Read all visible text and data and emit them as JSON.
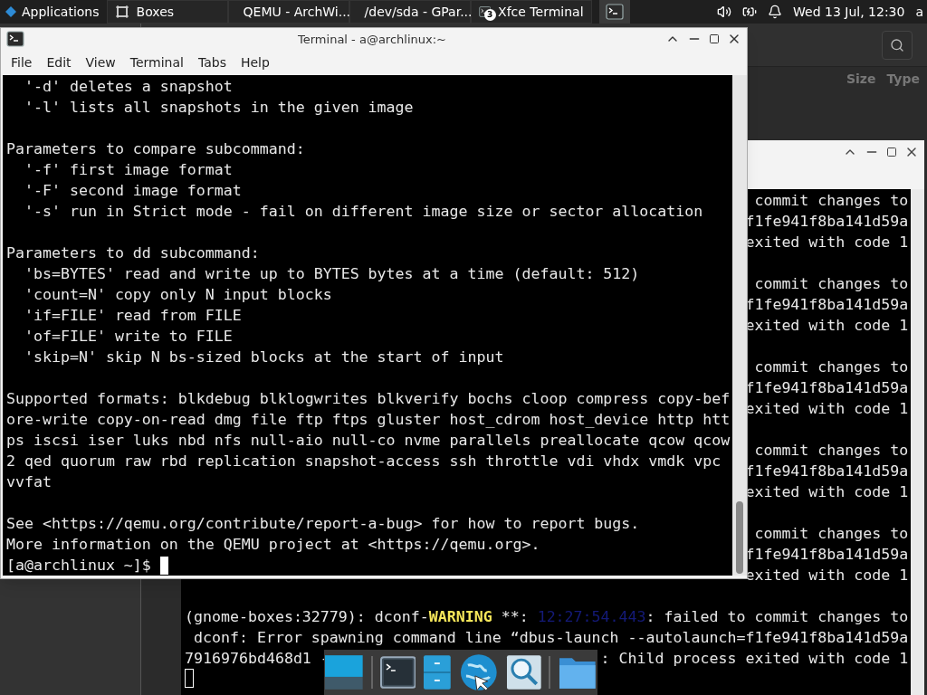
{
  "panel": {
    "app_menu": "Applications",
    "tasks": [
      {
        "label": "Boxes",
        "kind": "boxes"
      },
      {
        "label": "QEMU - ArchWi...",
        "kind": "browser"
      },
      {
        "label": "/dev/sda - GPar...",
        "kind": "disk"
      },
      {
        "label": "Xfce Terminal",
        "kind": "terminal",
        "badge": "3"
      }
    ],
    "clock": "Wed 13 Jul, 12:30",
    "user": "a"
  },
  "boxes_window": {
    "columns": [
      "Size",
      "Type"
    ]
  },
  "terminal": {
    "title": "Terminal - a@archlinux:~",
    "menu": [
      "File",
      "Edit",
      "View",
      "Terminal",
      "Tabs",
      "Help"
    ],
    "blocks": [
      [
        "  '-d' deletes a snapshot",
        "  '-l' lists all snapshots in the given image"
      ],
      [
        "Parameters to compare subcommand:",
        "  '-f' first image format",
        "  '-F' second image format",
        "  '-s' run in Strict mode - fail on different image size or sector allocation"
      ],
      [
        "Parameters to dd subcommand:",
        "  'bs=BYTES' read and write up to BYTES bytes at a time (default: 512)",
        "  'count=N' copy only N input blocks",
        "  'if=FILE' read from FILE",
        "  'of=FILE' write to FILE",
        "  'skip=N' skip N bs-sized blocks at the start of input"
      ],
      [
        "Supported formats: blkdebug blklogwrites blkverify bochs cloop compress copy-bef",
        "ore-write copy-on-read dmg file ftp ftps gluster host_cdrom host_device http htt",
        "ps iscsi iser luks nbd nfs null-aio null-co nvme parallels preallocate qcow qcow",
        "2 qed quorum raw rbd replication snapshot-access ssh throttle vdi vhdx vmdk vpc",
        "vvfat"
      ],
      [
        "See <https://qemu.org/contribute/report-a-bug> for how to report bugs.",
        "More information on the QEMU project at <https://qemu.org>."
      ]
    ],
    "prompt": "[a@archlinux ~]$"
  },
  "back_terminal": {
    "messages": [
      [
        "commit changes to",
        "f1fe941f8ba141d59a",
        "exited with code 1"
      ],
      [
        "commit changes to",
        "f1fe941f8ba141d59a",
        "exited with code 1"
      ],
      [
        "commit changes to",
        "f1fe941f8ba141d59a",
        "exited with code 1"
      ],
      [
        "commit changes to",
        "f1fe941f8ba141d59a",
        "exited with code 1"
      ],
      [
        "commit changes to",
        "f1fe941f8ba141d59a",
        "exited with code 1"
      ]
    ],
    "log_lines": [
      {
        "left": [
          {
            "kind": "text",
            "text": "(gnome-boxes:32779): dconf-"
          },
          {
            "kind": "warning",
            "text": "WARNING"
          },
          {
            "kind": "text",
            "text": " **: "
          },
          {
            "kind": "timestamp",
            "text": "12:27:54.443"
          },
          {
            "kind": "text",
            "text": ": failed to commit changes to"
          }
        ]
      },
      {
        "left": [
          {
            "kind": "text",
            "text": " dconf: Error spawning command line “dbus-launch --autolaunch=f1fe941f8ba141d59a"
          }
        ]
      },
      {
        "left": [
          {
            "kind": "text",
            "text": "7916976bd468d1 -"
          }
        ],
        "right": [
          {
            "kind": "text",
            "text": ": Child process exited with code 1"
          }
        ]
      }
    ]
  },
  "dock": {
    "items": [
      {
        "kind": "desktop"
      },
      {
        "kind": "terminal"
      },
      {
        "kind": "cabinet"
      },
      {
        "kind": "globe"
      },
      {
        "kind": "magnifier"
      },
      {
        "kind": "folder"
      }
    ]
  }
}
